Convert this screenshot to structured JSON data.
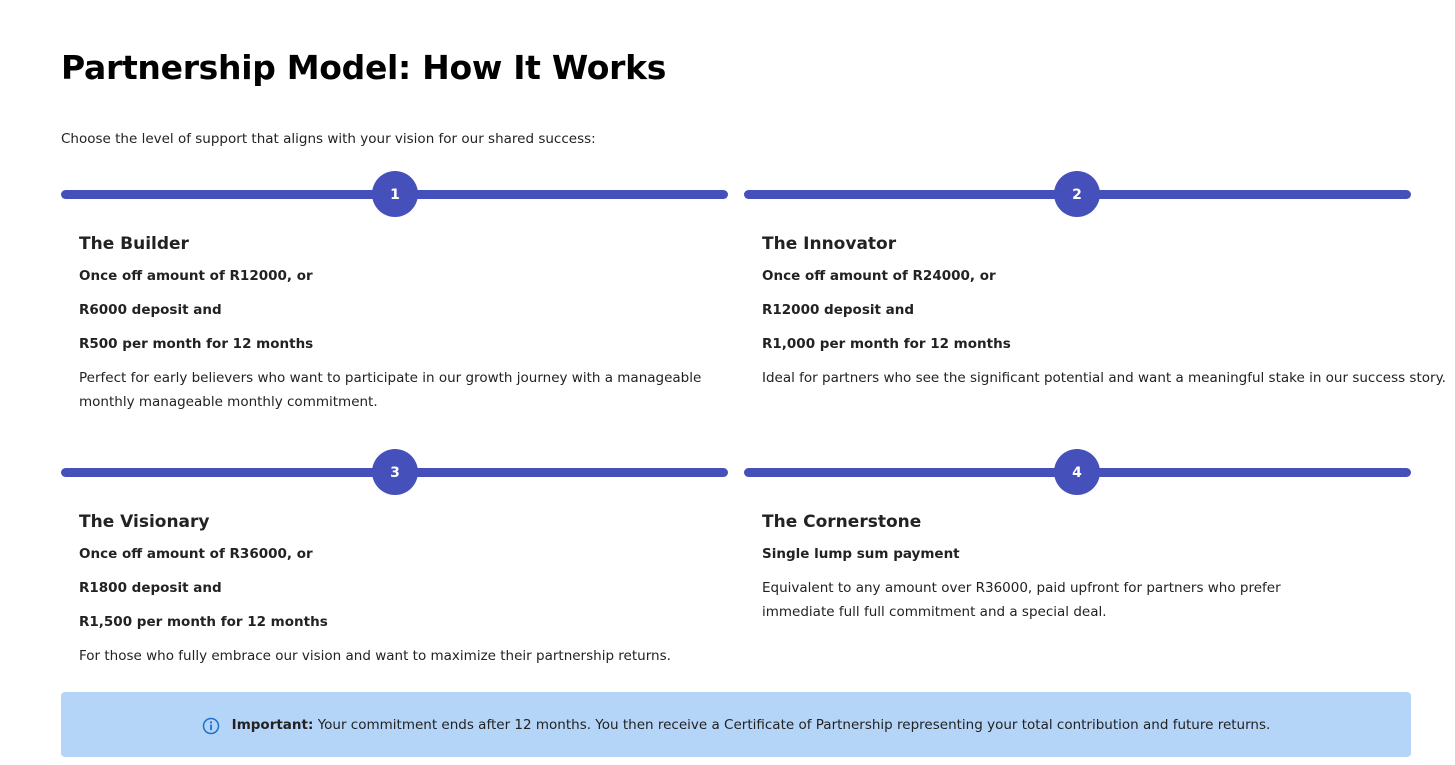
{
  "page": {
    "title": "Partnership Model: How It Works",
    "intro": "Choose the level of support that aligns with your vision for our shared success:"
  },
  "colors": {
    "accent": "#4650ba",
    "notice_bg": "#b5d5f8",
    "notice_icon": "#1a73c9"
  },
  "tiers": [
    {
      "number": "1",
      "name": "The Builder",
      "lines": [
        "Once off amount of R12000, or",
        "R6000 deposit and",
        "R500 per month for 12 months"
      ],
      "description": "Perfect for early believers who want to participate in our growth journey with a manageable monthly manageable monthly commitment."
    },
    {
      "number": "2",
      "name": "The Innovator",
      "lines": [
        "Once off amount of R24000, or",
        "R12000 deposit and",
        "R1,000 per month for 12 months"
      ],
      "description": "Ideal for partners who see the significant potential and want a meaningful stake in our success story."
    },
    {
      "number": "3",
      "name": "The Visionary",
      "lines": [
        "Once off amount of R36000, or",
        "R1800 deposit and",
        "R1,500 per month for 12 months"
      ],
      "description": "For those who fully embrace our vision and want to maximize their partnership returns."
    },
    {
      "number": "4",
      "name": "The Cornerstone",
      "lines": [
        "Single lump sum payment"
      ],
      "description": "Equivalent to any amount over R36000, paid upfront for partners who prefer immediate full full commitment and a special deal."
    }
  ],
  "notice": {
    "icon": "info-icon",
    "label": "Important:",
    "text": "Your commitment ends after 12 months. You then receive a Certificate of Partnership representing your total contribution and future returns."
  }
}
